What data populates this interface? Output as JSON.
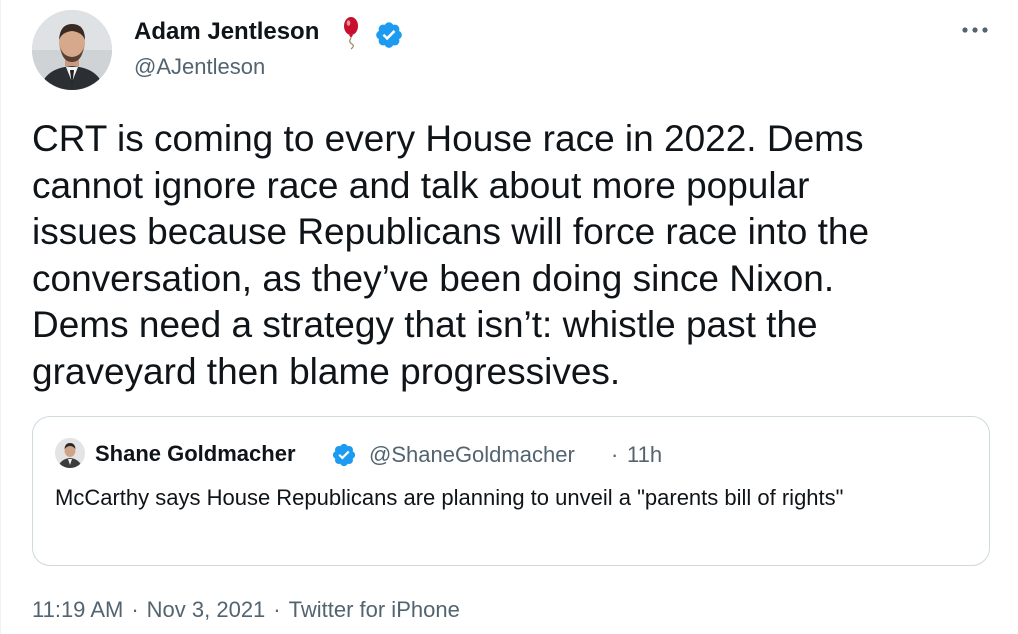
{
  "author": {
    "name": "Adam Jentleson",
    "handle": "@AJentleson"
  },
  "tweet": {
    "text": "CRT is coming to every House race in 2022. Dems\ncannot ignore race and talk about more popular\nissues because Republicans will force race into the\nconversation, as they’ve been doing since Nixon.\nDems need a strategy that isn’t: whistle past the\ngraveyard then blame progressives."
  },
  "quote": {
    "name": "Shane Goldmacher",
    "handle": "@ShaneGoldmacher",
    "separator": "·",
    "time": "11h",
    "text": "McCarthy says House Republicans are planning to unveil a \"parents bill of rights\""
  },
  "meta": {
    "time": "11:19 AM",
    "date": "Nov 3, 2021",
    "source": "Twitter for iPhone",
    "separator": "·"
  },
  "icons": {
    "balloon": "balloon-icon",
    "verified": "verified-badge-icon",
    "more": "more-horizontal-icon"
  },
  "colors": {
    "text": "#0f1419",
    "secondary": "#536471",
    "verified": "#1d9bf0",
    "border": "#cfd9de",
    "balloon": "#c8102e"
  }
}
